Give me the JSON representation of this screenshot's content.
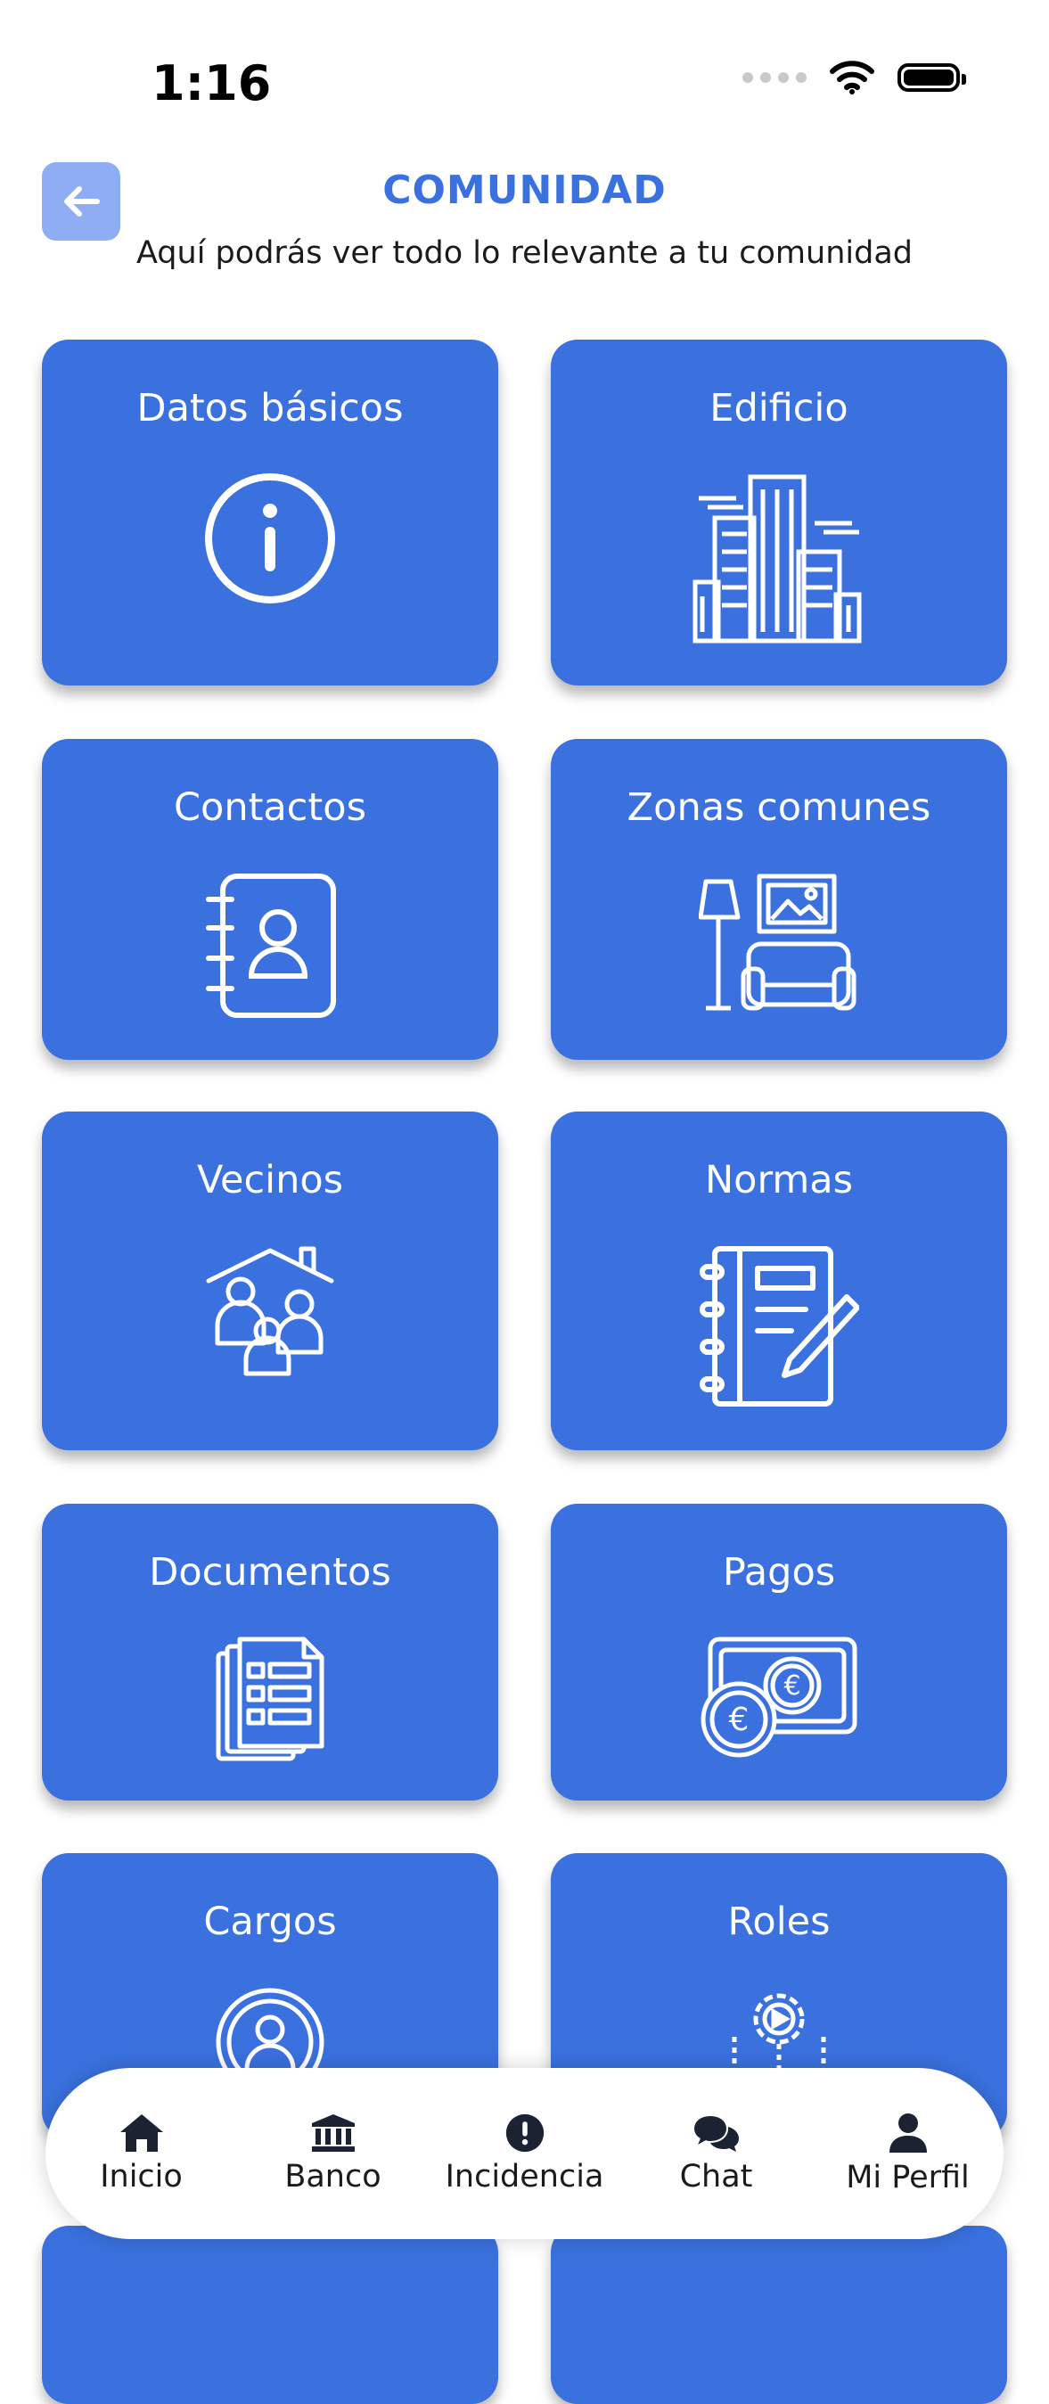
{
  "status_bar": {
    "time": "1:16"
  },
  "header": {
    "title": "COMUNIDAD",
    "subtitle": "Aquí podrás ver todo lo relevante a tu comunidad"
  },
  "cards": [
    {
      "label": "Datos básicos",
      "icon": "info-icon"
    },
    {
      "label": "Edificio",
      "icon": "building-icon"
    },
    {
      "label": "Contactos",
      "icon": "contact-book-icon"
    },
    {
      "label": "Zonas comunes",
      "icon": "common-area-icon"
    },
    {
      "label": "Vecinos",
      "icon": "neighbors-icon"
    },
    {
      "label": "Normas",
      "icon": "rules-notebook-icon"
    },
    {
      "label": "Documentos",
      "icon": "documents-icon"
    },
    {
      "label": "Pagos",
      "icon": "payments-icon"
    },
    {
      "label": "Cargos",
      "icon": "user-badge-icon"
    },
    {
      "label": "Roles",
      "icon": "roles-gear-icon"
    }
  ],
  "bottom_nav": [
    {
      "label": "Inicio",
      "icon": "home-icon"
    },
    {
      "label": "Banco",
      "icon": "bank-icon"
    },
    {
      "label": "Incidencia",
      "icon": "alert-icon"
    },
    {
      "label": "Chat",
      "icon": "chat-icon"
    },
    {
      "label": "Mi Perfil",
      "icon": "profile-icon"
    }
  ],
  "colors": {
    "accent": "#3A71DE",
    "back_button": "#8EADF3",
    "background": "#FFFFFF"
  }
}
